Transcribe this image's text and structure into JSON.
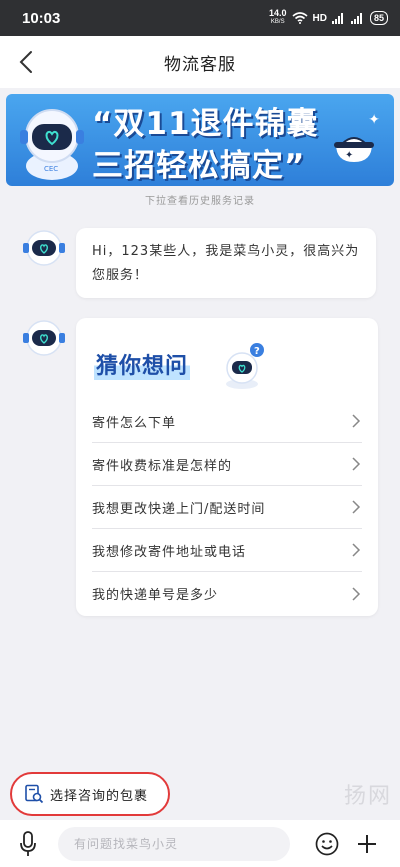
{
  "status_bar": {
    "time": "10:03",
    "net_speed": "14.0",
    "net_unit": "KB/S",
    "hd_label": "HD",
    "battery": "85"
  },
  "header": {
    "title": "物流客服"
  },
  "banner": {
    "line1": "“双11退件锦囊",
    "line2": "三招轻松搞定”",
    "robot_badge": "CEC",
    "colors": {
      "background": "#2e7fd9",
      "text": "#ffffff"
    }
  },
  "history_hint": "下拉查看历史服务记录",
  "greeting": {
    "text": "Hi，123某些人，我是菜鸟小灵，很高兴为您服务！"
  },
  "faq": {
    "title": "猜你想问",
    "items": [
      {
        "label": "寄件怎么下单"
      },
      {
        "label": "寄件收费标准是怎样的"
      },
      {
        "label": "我想更改快递上门/配送时间"
      },
      {
        "label": "我想修改寄件地址或电话"
      },
      {
        "label": "我的快递单号是多少"
      }
    ]
  },
  "select_package": {
    "label": "选择咨询的包裹"
  },
  "input_bar": {
    "placeholder": "有问题找菜鸟小灵"
  },
  "watermark": "扬网",
  "colors": {
    "accent": "#1e4fa8",
    "highlight_border": "#e23a3a",
    "page_bg": "#f1f1f5"
  }
}
